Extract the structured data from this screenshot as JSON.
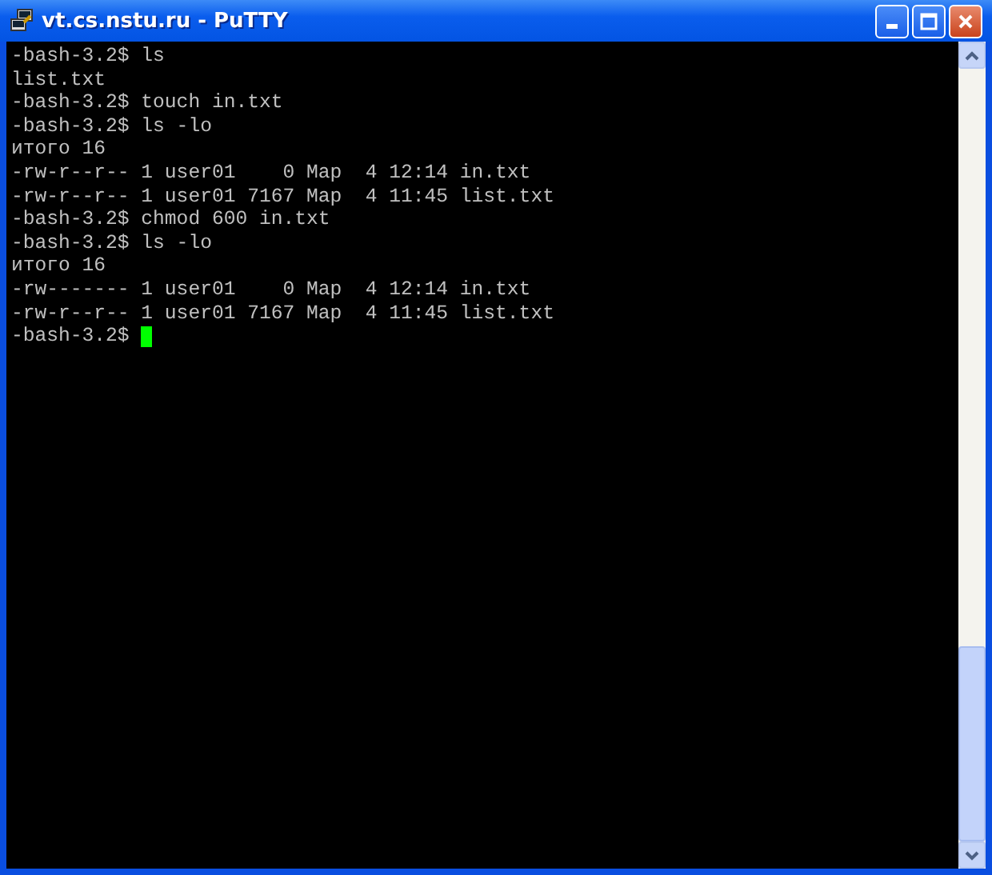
{
  "window": {
    "title": "vt.cs.nstu.ru - PuTTY"
  },
  "terminal": {
    "lines": [
      "-bash-3.2$ ls",
      "list.txt",
      "-bash-3.2$ touch in.txt",
      "-bash-3.2$ ls -lo",
      "итого 16",
      "-rw-r--r-- 1 user01    0 Map  4 12:14 in.txt",
      "-rw-r--r-- 1 user01 7167 Map  4 11:45 list.txt",
      "-bash-3.2$ chmod 600 in.txt",
      "-bash-3.2$ ls -lo",
      "итого 16",
      "-rw------- 1 user01    0 Map  4 12:14 in.txt",
      "-rw-r--r-- 1 user01 7167 Map  4 11:45 list.txt"
    ],
    "prompt": "-bash-3.2$ "
  }
}
